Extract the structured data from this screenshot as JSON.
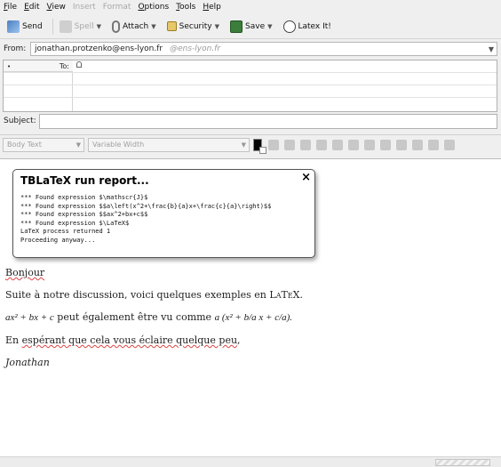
{
  "menubar": {
    "items": [
      {
        "label": "File",
        "key": "F",
        "rest": "ile",
        "enabled": true
      },
      {
        "label": "Edit",
        "key": "E",
        "rest": "dit",
        "enabled": true
      },
      {
        "label": "View",
        "key": "V",
        "rest": "iew",
        "enabled": true
      },
      {
        "label": "Insert",
        "key": "",
        "rest": "Insert",
        "enabled": false
      },
      {
        "label": "Format",
        "key": "",
        "rest": "Format",
        "enabled": false
      },
      {
        "label": "Options",
        "key": "O",
        "rest": "ptions",
        "enabled": true
      },
      {
        "label": "Tools",
        "key": "T",
        "rest": "ools",
        "enabled": true
      },
      {
        "label": "Help",
        "key": "H",
        "rest": "elp",
        "enabled": true
      }
    ]
  },
  "toolbar": {
    "send_label": "Send",
    "spell_label": "Spell",
    "attach_label": "Attach",
    "security_label": "Security",
    "save_label": "Save",
    "latex_label": "Latex It!"
  },
  "from": {
    "label": "From:",
    "address": "jonathan.protzenko@ens-lyon.fr",
    "identity_hint": "@ens-lyon.fr"
  },
  "recipients": {
    "to_label": "To:",
    "dot": "•"
  },
  "subject": {
    "label": "Subject:",
    "value": ""
  },
  "format": {
    "paragraph_style": "Body Text",
    "font": "Variable Width"
  },
  "editor": {
    "greeting": "Bonjour",
    "line1_text": "Suite à notre discussion, voici quelques exemples en ",
    "line1_latex": "LaTeX.",
    "line2_math": "ax² + bx + c",
    "line2_text": " peut également être vu comme ",
    "line2_math2": "a (x² + b/a x + c/a).",
    "line3_prefix": "En ",
    "line3_squig": "espérant que cela vous éclaire quelque peu",
    "line3_suffix": ",",
    "signature": "Jonathan"
  },
  "popup": {
    "title": "TBLaTeX run report...",
    "close": "×",
    "log": [
      "*** Found expression $\\mathscr{J}$",
      "*** Found expression $$a\\left(x^2+\\frac{b}{a}x+\\frac{c}{a}\\right)$$",
      "*** Found expression $$ax^2+bx+c$$",
      "*** Found expression $\\LaTeX$",
      "LaTeX process returned 1",
      "Proceeding anyway..."
    ]
  },
  "colors": {
    "spellcheck_underline": "#dd4444",
    "window_bg": "#efefef"
  }
}
